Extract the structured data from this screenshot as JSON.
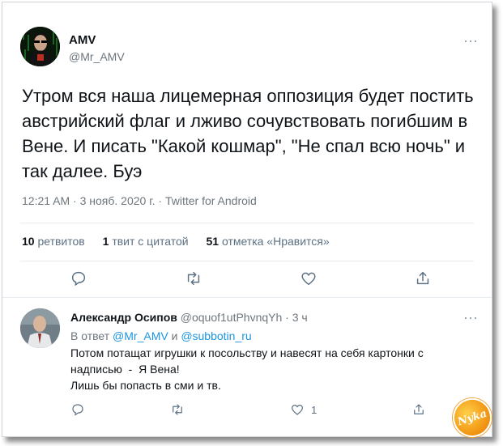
{
  "tweet": {
    "author_name": "AMV",
    "author_handle": "@Mr_AMV",
    "text": "Утром вся наша лицемерная оппозиция будет постить австрийский флаг и лживо сочувствовать погибшим в Вене. И писать \"Какой кошмар\", \"Не спал всю ночь\" и так далее. Буэ",
    "time": "12:21 AM",
    "date": "3 нояб. 2020 г.",
    "source": "Twitter for Android",
    "separator": " · ",
    "stats": {
      "retweets_count": "10",
      "retweets_label": "ретвитов",
      "quotes_count": "1",
      "quotes_label": "твит с цитатой",
      "likes_count": "51",
      "likes_label": "отметка «Нравится»"
    },
    "more_label": "···"
  },
  "reply": {
    "author_name": "Александр Осипов",
    "author_handle": "@oquof1utPhvnqYh",
    "separator": " · ",
    "time": "3 ч",
    "replying_prefix": "В ответ",
    "replying_to_1": "@Mr_AMV",
    "replying_and": "и",
    "replying_to_2": "@subbotin_ru",
    "lines": [
      "Потом потащат игрушки к посольству и навесят на себя картонки с",
      "надписью  -  Я Вена!",
      "Лишь бы попасть в сми и тв."
    ],
    "like_count": "1",
    "more_label": "···"
  },
  "watermark": "Nyka",
  "colors": {
    "text": "#0f1419",
    "secondary": "#6e767d",
    "link": "#1b95e0",
    "icon": "#5b7083",
    "divider": "#e6ecf0"
  }
}
